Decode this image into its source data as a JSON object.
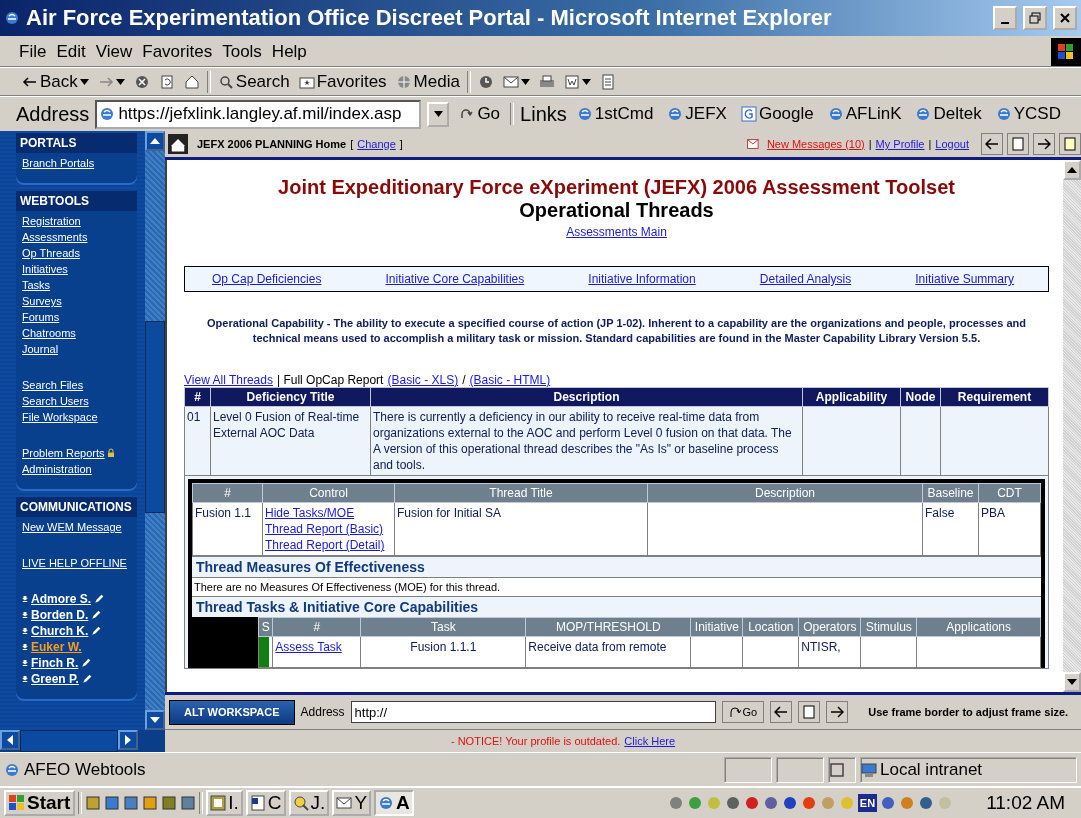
{
  "window": {
    "title": "Air Force Experimentation Office Discreet Portal - Microsoft Internet Explorer"
  },
  "menu": [
    "File",
    "Edit",
    "View",
    "Favorites",
    "Tools",
    "Help"
  ],
  "toolbar": [
    {
      "kind": "back",
      "label": "Back",
      "dropdown": true
    },
    {
      "kind": "forward",
      "dropdown": true
    },
    {
      "kind": "stop"
    },
    {
      "kind": "refresh"
    },
    {
      "kind": "home"
    },
    {
      "kind": "search",
      "label": "Search"
    },
    {
      "kind": "favorites",
      "label": "Favorites"
    },
    {
      "kind": "media",
      "label": "Media"
    },
    {
      "kind": "history"
    },
    {
      "kind": "mail",
      "dropdown": true
    },
    {
      "kind": "print"
    },
    {
      "kind": "edit",
      "dropdown": true
    },
    {
      "kind": "discuss"
    }
  ],
  "address": {
    "label": "Address",
    "value": "https://jefxlink.langley.af.mil/index.asp",
    "go": "Go"
  },
  "links": {
    "label": "Links",
    "items": [
      {
        "label": "1stCmd",
        "kind": "ie"
      },
      {
        "label": "JEFX",
        "kind": "ie"
      },
      {
        "label": "Google",
        "kind": "google"
      },
      {
        "label": "AFLinK",
        "kind": "ie"
      },
      {
        "label": "Deltek",
        "kind": "ie"
      },
      {
        "label": "YCSD",
        "kind": "ie"
      }
    ]
  },
  "sidebar": [
    {
      "title": "PORTALS",
      "groups": [
        [
          {
            "label": "Branch Portals",
            "locked": false
          }
        ]
      ]
    },
    {
      "title": "WEBTOOLS",
      "groups": [
        [
          {
            "label": "Registration",
            "locked": false
          },
          {
            "label": "Assessments",
            "locked": false
          },
          {
            "label": "Op Threads",
            "locked": false
          },
          {
            "label": "Initiatives",
            "locked": false
          },
          {
            "label": "Tasks",
            "locked": false
          },
          {
            "label": "Surveys",
            "locked": false
          },
          {
            "label": "Forums",
            "locked": false
          },
          {
            "label": "Chatrooms",
            "locked": false
          },
          {
            "label": "Journal",
            "locked": false
          }
        ],
        [
          {
            "label": "Search Files",
            "locked": false
          },
          {
            "label": "Search Users",
            "locked": false
          },
          {
            "label": "File Workspace",
            "locked": false
          }
        ],
        [
          {
            "label": "Problem Reports",
            "locked": true
          },
          {
            "label": "Administration",
            "locked": false
          }
        ]
      ]
    },
    {
      "title": "COMMUNICATIONS",
      "groups": [
        [
          {
            "label": "New WEM Message",
            "locked": false
          }
        ],
        [
          {
            "label": "LIVE HELP OFFLINE",
            "locked": false
          }
        ]
      ],
      "users": [
        {
          "name": "Admore S.",
          "selected": false,
          "pencil": true
        },
        {
          "name": "Borden D.",
          "selected": false,
          "pencil": true
        },
        {
          "name": "Church K.",
          "selected": false,
          "pencil": true
        },
        {
          "name": "Euker W.",
          "selected": true,
          "pencil": false
        },
        {
          "name": "Finch R.",
          "selected": false,
          "pencil": true
        },
        {
          "name": "Green P.",
          "selected": false,
          "pencil": true
        }
      ]
    }
  ],
  "frame_header": {
    "home": "JEFX 2006 PLANNING Home",
    "change_open": "[",
    "change": "Change",
    "change_close": "]",
    "messages": "New Messages (10)",
    "sep1": "|",
    "profile": "My Profile",
    "sep2": "|",
    "logout": "Logout"
  },
  "page": {
    "title": "Joint Expeditionary Force eXperiment (JEFX) 2006 Assessment Toolset",
    "subtitle": "Operational Threads",
    "main_link": "Assessments Main",
    "nav": [
      "Op Cap Deficiencies",
      "Initiative Core Capabilities",
      "Initiative Information",
      "Detailed Analysis",
      "Initiative Summary"
    ],
    "definition": "Operational Capability - The ability to execute a specified course of action (JP 1-02). Inherent to a capability are the organizations and people, processes and technical means used to accomplish a military task or mission. Standard capabilities are found in the Master Capability Library Version 5.5.",
    "report_links": [
      {
        "kind": "link",
        "text": "View All Threads"
      },
      {
        "kind": "text",
        "text": "| Full OpCap Report"
      },
      {
        "kind": "link",
        "text": "(Basic - XLS)"
      },
      {
        "kind": "text",
        "text": "/"
      },
      {
        "kind": "link",
        "text": "(Basic - HTML)"
      }
    ],
    "deficiency_table": {
      "columns": [
        "#",
        "Deficiency Title",
        "Description",
        "Applicability",
        "Node",
        "Requirement"
      ],
      "rows": [
        [
          "01",
          "Level 0 Fusion of Real-time External AOC Data",
          "There is currently a deficiency in our ability to receive real-time data from organizations external to the AOC and perform Level 0 fusion on that data. The A version of this operational thread describes the \"As Is\" or baseline process and tools.",
          "",
          "",
          ""
        ]
      ]
    },
    "thread_table": {
      "columns": [
        "#",
        "Control",
        "Thread Title",
        "Description",
        "Baseline",
        "CDT"
      ],
      "rows": [
        {
          "number": "Fusion 1.1",
          "controls": [
            "Hide Tasks/MOE",
            "Thread Report (Basic)",
            "Thread Report (Detail)"
          ],
          "title": "Fusion for Initial SA",
          "description": "",
          "baseline": "False",
          "cdt": "PBA"
        }
      ]
    },
    "moe": {
      "title": "Thread Measures Of Effectiveness",
      "text": "There are no Measures Of Effectiveness (MOE) for this thread."
    },
    "tasks": {
      "title": "Thread Tasks & Initiative Core Capabilities",
      "columns": [
        "S",
        "#",
        "Task",
        "MOP/THRESHOLD",
        "Initiative",
        "Location",
        "Operators",
        "Stimulus",
        "Applications"
      ],
      "rows": [
        {
          "color": "#108010",
          "link": "Assess Task",
          "task": "Fusion 1.1.1",
          "mop": "Receive data from remote",
          "operators": "NTISR,"
        }
      ]
    }
  },
  "alt_bar": {
    "button": "ALT WORKSPACE",
    "address_label": "Address",
    "address_value": "http://",
    "go": "Go",
    "hint": "Use frame border to adjust frame size."
  },
  "notice": {
    "text": "- NOTICE! Your profile is outdated.",
    "link": "Click Here"
  },
  "status_bar": {
    "text": "AFEO Webtools",
    "zone": "Local intranet"
  },
  "taskbar": {
    "start": "Start",
    "tasks": [
      {
        "label": "I.",
        "kind": "image",
        "selected": false
      },
      {
        "label": "C",
        "kind": "word",
        "selected": false
      },
      {
        "label": "J.",
        "kind": "find",
        "selected": false
      },
      {
        "label": "Y",
        "kind": "mail",
        "selected": false
      },
      {
        "label": "A",
        "kind": "ie",
        "selected": true
      }
    ],
    "language": "EN",
    "clock": "11:02 AM"
  }
}
